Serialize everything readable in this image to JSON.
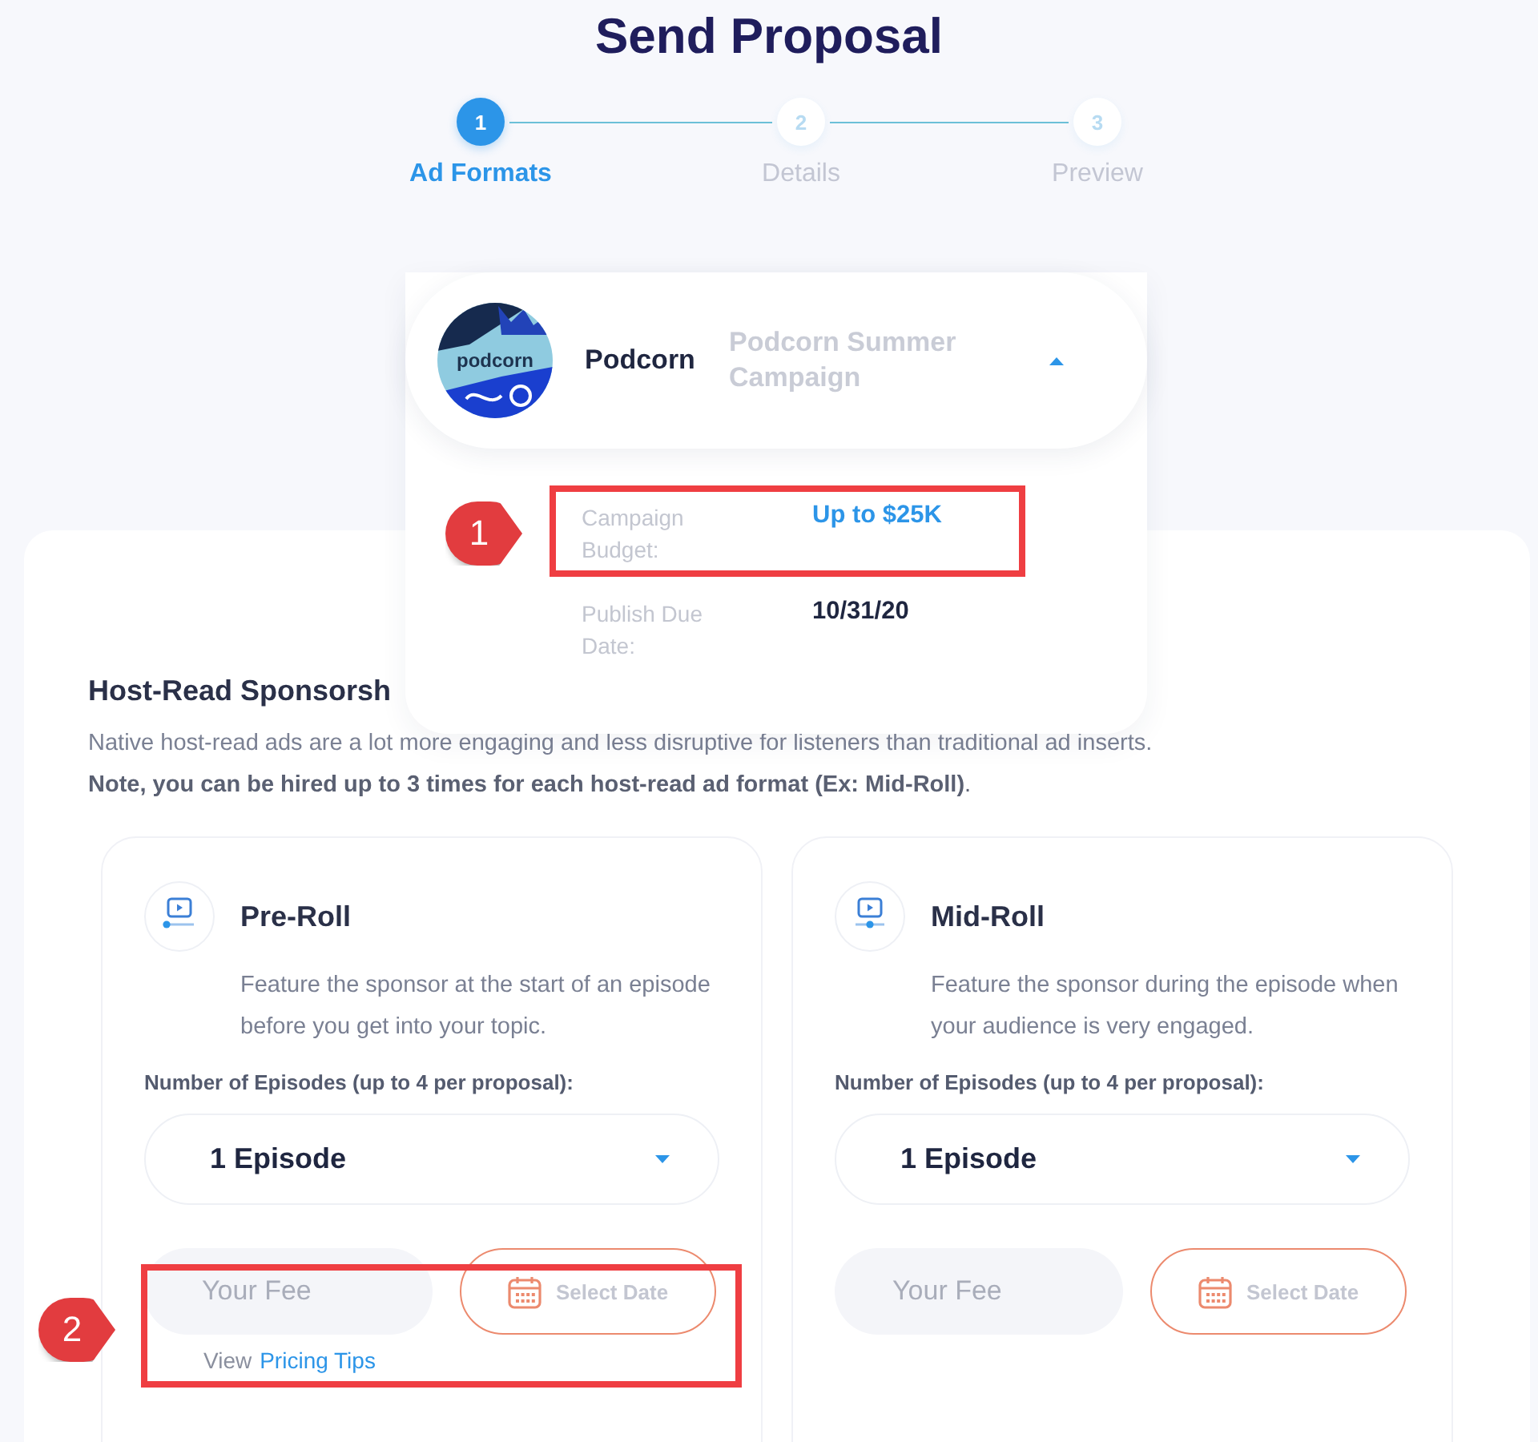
{
  "title": "Send Proposal",
  "steps": [
    {
      "number": "1",
      "label": "Ad Formats",
      "selected": true
    },
    {
      "number": "2",
      "label": "Details",
      "selected": false
    },
    {
      "number": "3",
      "label": "Preview",
      "selected": false
    }
  ],
  "campaign_picker": {
    "logo_text": "podcorn",
    "brand": "Podcorn",
    "campaign": "Podcorn Summer Campaign",
    "expanded": true,
    "details": [
      {
        "label": "Campaign Budget:",
        "value": "Up to $25K",
        "highlight": true
      },
      {
        "label": "Publish Due Date:",
        "value": "10/31/20",
        "highlight": false
      }
    ]
  },
  "section": {
    "heading": "Host-Read Sponsorsh",
    "description": "Native host-read ads are a lot more engaging and less disruptive for listeners than traditional ad inserts.",
    "note": "**Note, you can be hired up to 3 times for each host-read ad format (Ex: Mid-Roll)**."
  },
  "formats": [
    {
      "title": "Pre-Roll",
      "description": "Feature the sponsor at the start of an episode before you get into your topic.",
      "episodes_label": "Number of Episodes (up to 4 per proposal):",
      "episodes": "1 Episode",
      "fee": {
        "placeholder": "Your Fee"
      },
      "date_button": "Select Date",
      "link_prefix": "View",
      "link": "Pricing Tips"
    },
    {
      "title": "Mid-Roll",
      "description": "Feature the sponsor during the episode when your audience is very engaged.",
      "episodes_label": "Number of Episodes (up to 4 per proposal):",
      "episodes": "1 Episode",
      "fee": {
        "placeholder": "Your Fee"
      },
      "date_button": "Select Date"
    }
  ],
  "annotations": [
    {
      "number": "1"
    },
    {
      "number": "2"
    }
  ]
}
